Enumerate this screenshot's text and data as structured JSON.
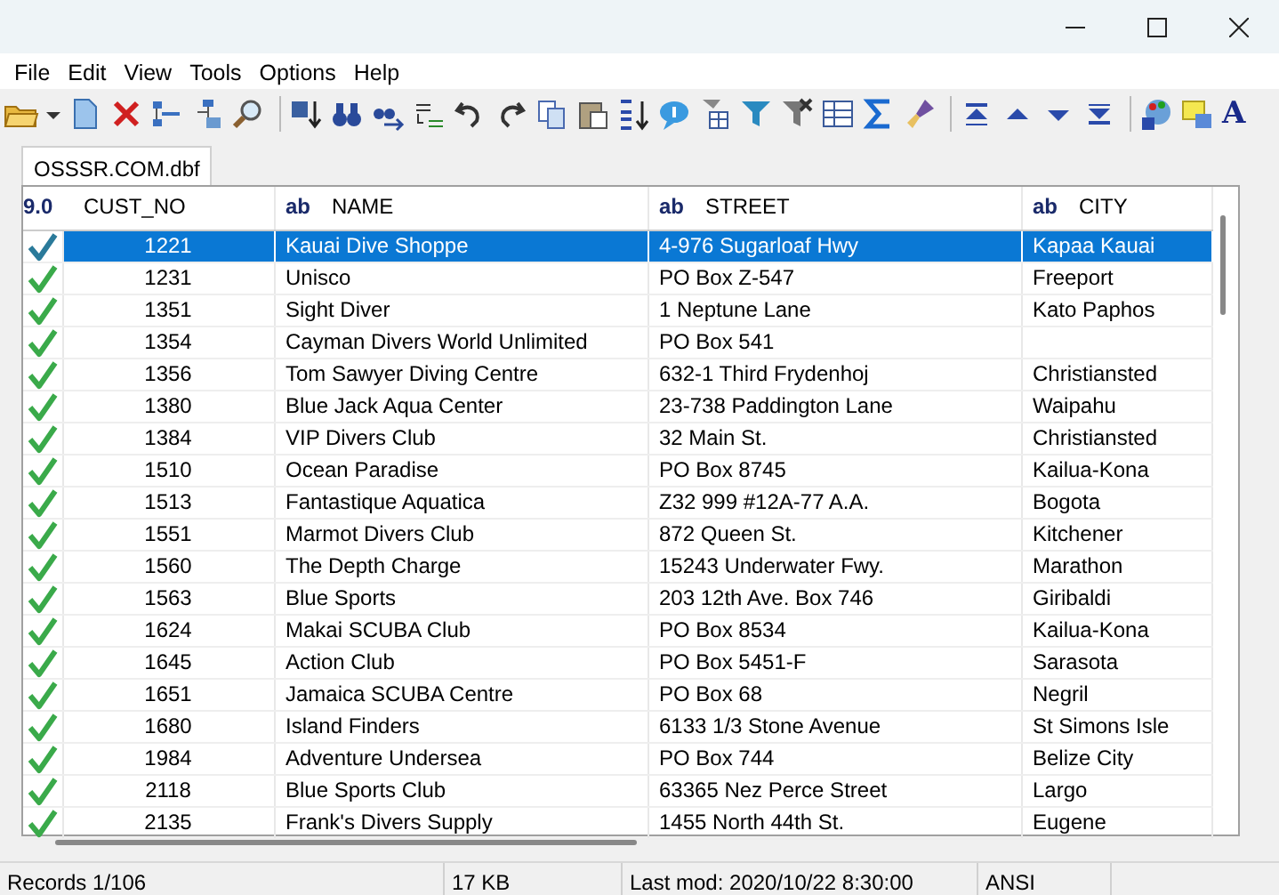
{
  "menu": [
    {
      "label": "File"
    },
    {
      "label": "Edit"
    },
    {
      "label": "View"
    },
    {
      "label": "Tools"
    },
    {
      "label": "Options"
    },
    {
      "label": "Help"
    }
  ],
  "toolbar": {
    "font_button": "A"
  },
  "tabs": [
    {
      "label": "OSSSR.COM.dbf",
      "selected": true
    }
  ],
  "table": {
    "columns": [
      {
        "type": "9.0",
        "name": "CUST_NO"
      },
      {
        "type": "ab",
        "name": "NAME"
      },
      {
        "type": "ab",
        "name": "STREET"
      },
      {
        "type": "ab",
        "name": "CITY"
      }
    ],
    "rows": [
      {
        "selected": true,
        "cells": [
          "1221",
          "Kauai Dive Shoppe",
          "4-976 Sugarloaf Hwy",
          "Kapaa Kauai"
        ]
      },
      {
        "selected": false,
        "cells": [
          "1231",
          "Unisco",
          "PO Box Z-547",
          "Freeport"
        ]
      },
      {
        "selected": false,
        "cells": [
          "1351",
          "Sight Diver",
          "1 Neptune Lane",
          "Kato Paphos"
        ]
      },
      {
        "selected": false,
        "cells": [
          "1354",
          "Cayman Divers World Unlimited",
          "PO Box 541",
          ""
        ]
      },
      {
        "selected": false,
        "cells": [
          "1356",
          "Tom Sawyer Diving Centre",
          "632-1 Third Frydenhoj",
          "Christiansted"
        ]
      },
      {
        "selected": false,
        "cells": [
          "1380",
          "Blue Jack Aqua Center",
          "23-738 Paddington Lane",
          "Waipahu"
        ]
      },
      {
        "selected": false,
        "cells": [
          "1384",
          "VIP Divers Club",
          "32 Main St.",
          "Christiansted"
        ]
      },
      {
        "selected": false,
        "cells": [
          "1510",
          "Ocean Paradise",
          "PO Box 8745",
          "Kailua-Kona"
        ]
      },
      {
        "selected": false,
        "cells": [
          "1513",
          "Fantastique Aquatica",
          "Z32 999 #12A-77 A.A.",
          "Bogota"
        ]
      },
      {
        "selected": false,
        "cells": [
          "1551",
          "Marmot Divers Club",
          "872 Queen St.",
          "Kitchener"
        ]
      },
      {
        "selected": false,
        "cells": [
          "1560",
          "The Depth Charge",
          "15243 Underwater Fwy.",
          "Marathon"
        ]
      },
      {
        "selected": false,
        "cells": [
          "1563",
          "Blue Sports",
          "203 12th Ave. Box 746",
          "Giribaldi"
        ]
      },
      {
        "selected": false,
        "cells": [
          "1624",
          "Makai SCUBA Club",
          "PO Box 8534",
          "Kailua-Kona"
        ]
      },
      {
        "selected": false,
        "cells": [
          "1645",
          "Action Club",
          "PO Box 5451-F",
          "Sarasota"
        ]
      },
      {
        "selected": false,
        "cells": [
          "1651",
          "Jamaica SCUBA Centre",
          "PO Box 68",
          "Negril"
        ]
      },
      {
        "selected": false,
        "cells": [
          "1680",
          "Island Finders",
          "6133 1/3 Stone Avenue",
          "St Simons Isle"
        ]
      },
      {
        "selected": false,
        "cells": [
          "1984",
          "Adventure Undersea",
          "PO Box 744",
          "Belize City"
        ]
      },
      {
        "selected": false,
        "cells": [
          "2118",
          "Blue Sports Club",
          "63365 Nez Perce Street",
          "Largo"
        ]
      },
      {
        "selected": false,
        "cells": [
          "2135",
          "Frank's Divers Supply",
          "1455 North 44th St.",
          "Eugene"
        ]
      }
    ]
  },
  "status_bar": [
    "Records 1/106",
    "17 KB",
    "Last mod: 2020/10/22 8:30:00",
    "ANSI"
  ]
}
